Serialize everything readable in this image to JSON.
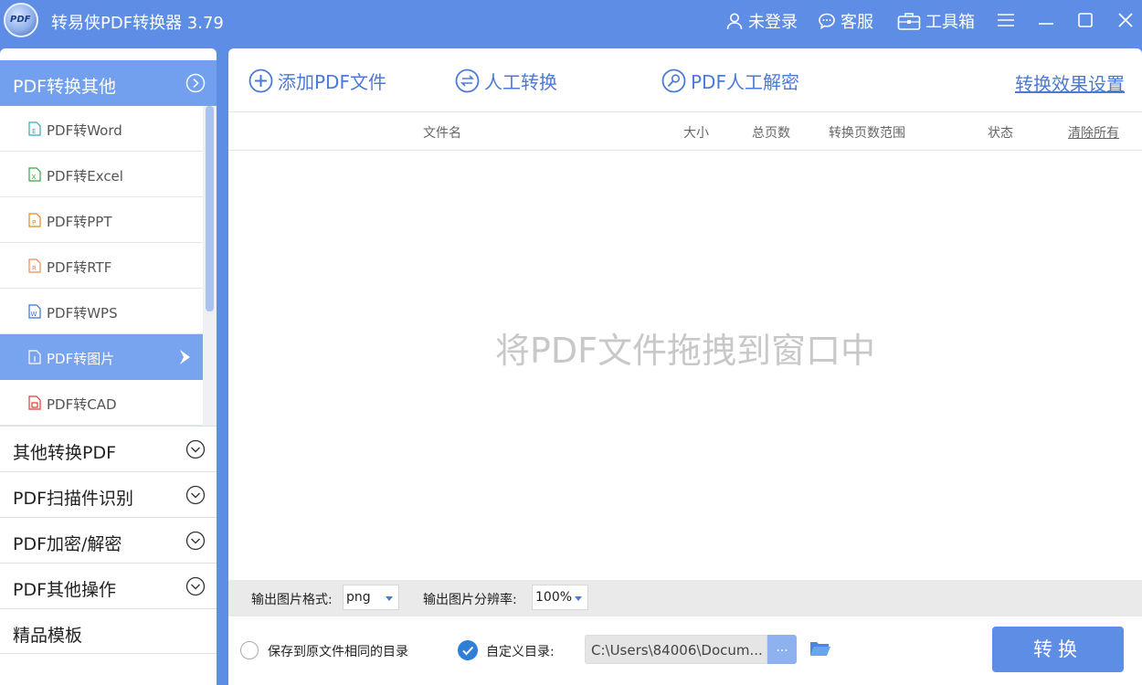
{
  "app": {
    "title": "转易侠PDF转换器 3.79",
    "logo_text": "PDF"
  },
  "titlebar": {
    "login_label": "未登录",
    "service_label": "客服",
    "toolbox_label": "工具箱"
  },
  "sidebar": {
    "header_label": "PDF转换其他",
    "sub_items": [
      {
        "label": "PDF转Word",
        "icon": "word-file-icon",
        "color": "#3aa7b8"
      },
      {
        "label": "PDF转Excel",
        "icon": "excel-file-icon",
        "color": "#3aa24a"
      },
      {
        "label": "PDF转PPT",
        "icon": "ppt-file-icon",
        "color": "#e08a1e"
      },
      {
        "label": "PDF转RTF",
        "icon": "rtf-file-icon",
        "color": "#e98a57"
      },
      {
        "label": "PDF转WPS",
        "icon": "wps-file-icon",
        "color": "#3a6fd6"
      },
      {
        "label": "PDF转图片",
        "icon": "image-file-icon",
        "color": "#ffffff"
      },
      {
        "label": "PDF转CAD",
        "icon": "cad-file-icon",
        "color": "#e03a3a"
      }
    ],
    "active_index": 5,
    "groups": [
      {
        "label": "其他转换PDF"
      },
      {
        "label": "PDF扫描件识别"
      },
      {
        "label": "PDF加密/解密"
      },
      {
        "label": "PDF其他操作"
      },
      {
        "label": "精品模板"
      }
    ]
  },
  "toolbar": {
    "add_label": "添加PDF文件",
    "manual_label": "人工转换",
    "decrypt_label": "PDF人工解密",
    "effect_settings_label": "转换效果设置"
  },
  "table": {
    "col_filename": "文件名",
    "col_size": "大小",
    "col_pages": "总页数",
    "col_range": "转换页数范围",
    "col_status": "状态",
    "clear_all": "清除所有"
  },
  "dropzone_text": "将PDF文件拖拽到窗口中",
  "options": {
    "format_label": "输出图片格式:",
    "format_value": "png",
    "resolution_label": "输出图片分辨率:",
    "resolution_value": "100%"
  },
  "output": {
    "same_dir_label": "保存到原文件相同的目录",
    "custom_dir_label": "自定义目录:",
    "path_value": "C:\\Users\\84006\\Docum...",
    "browse_label": "...",
    "convert_label": "转换"
  },
  "colors": {
    "brand": "#5e8de6",
    "accent_text": "#4b7ad6",
    "active_item": "#78a3ee"
  }
}
